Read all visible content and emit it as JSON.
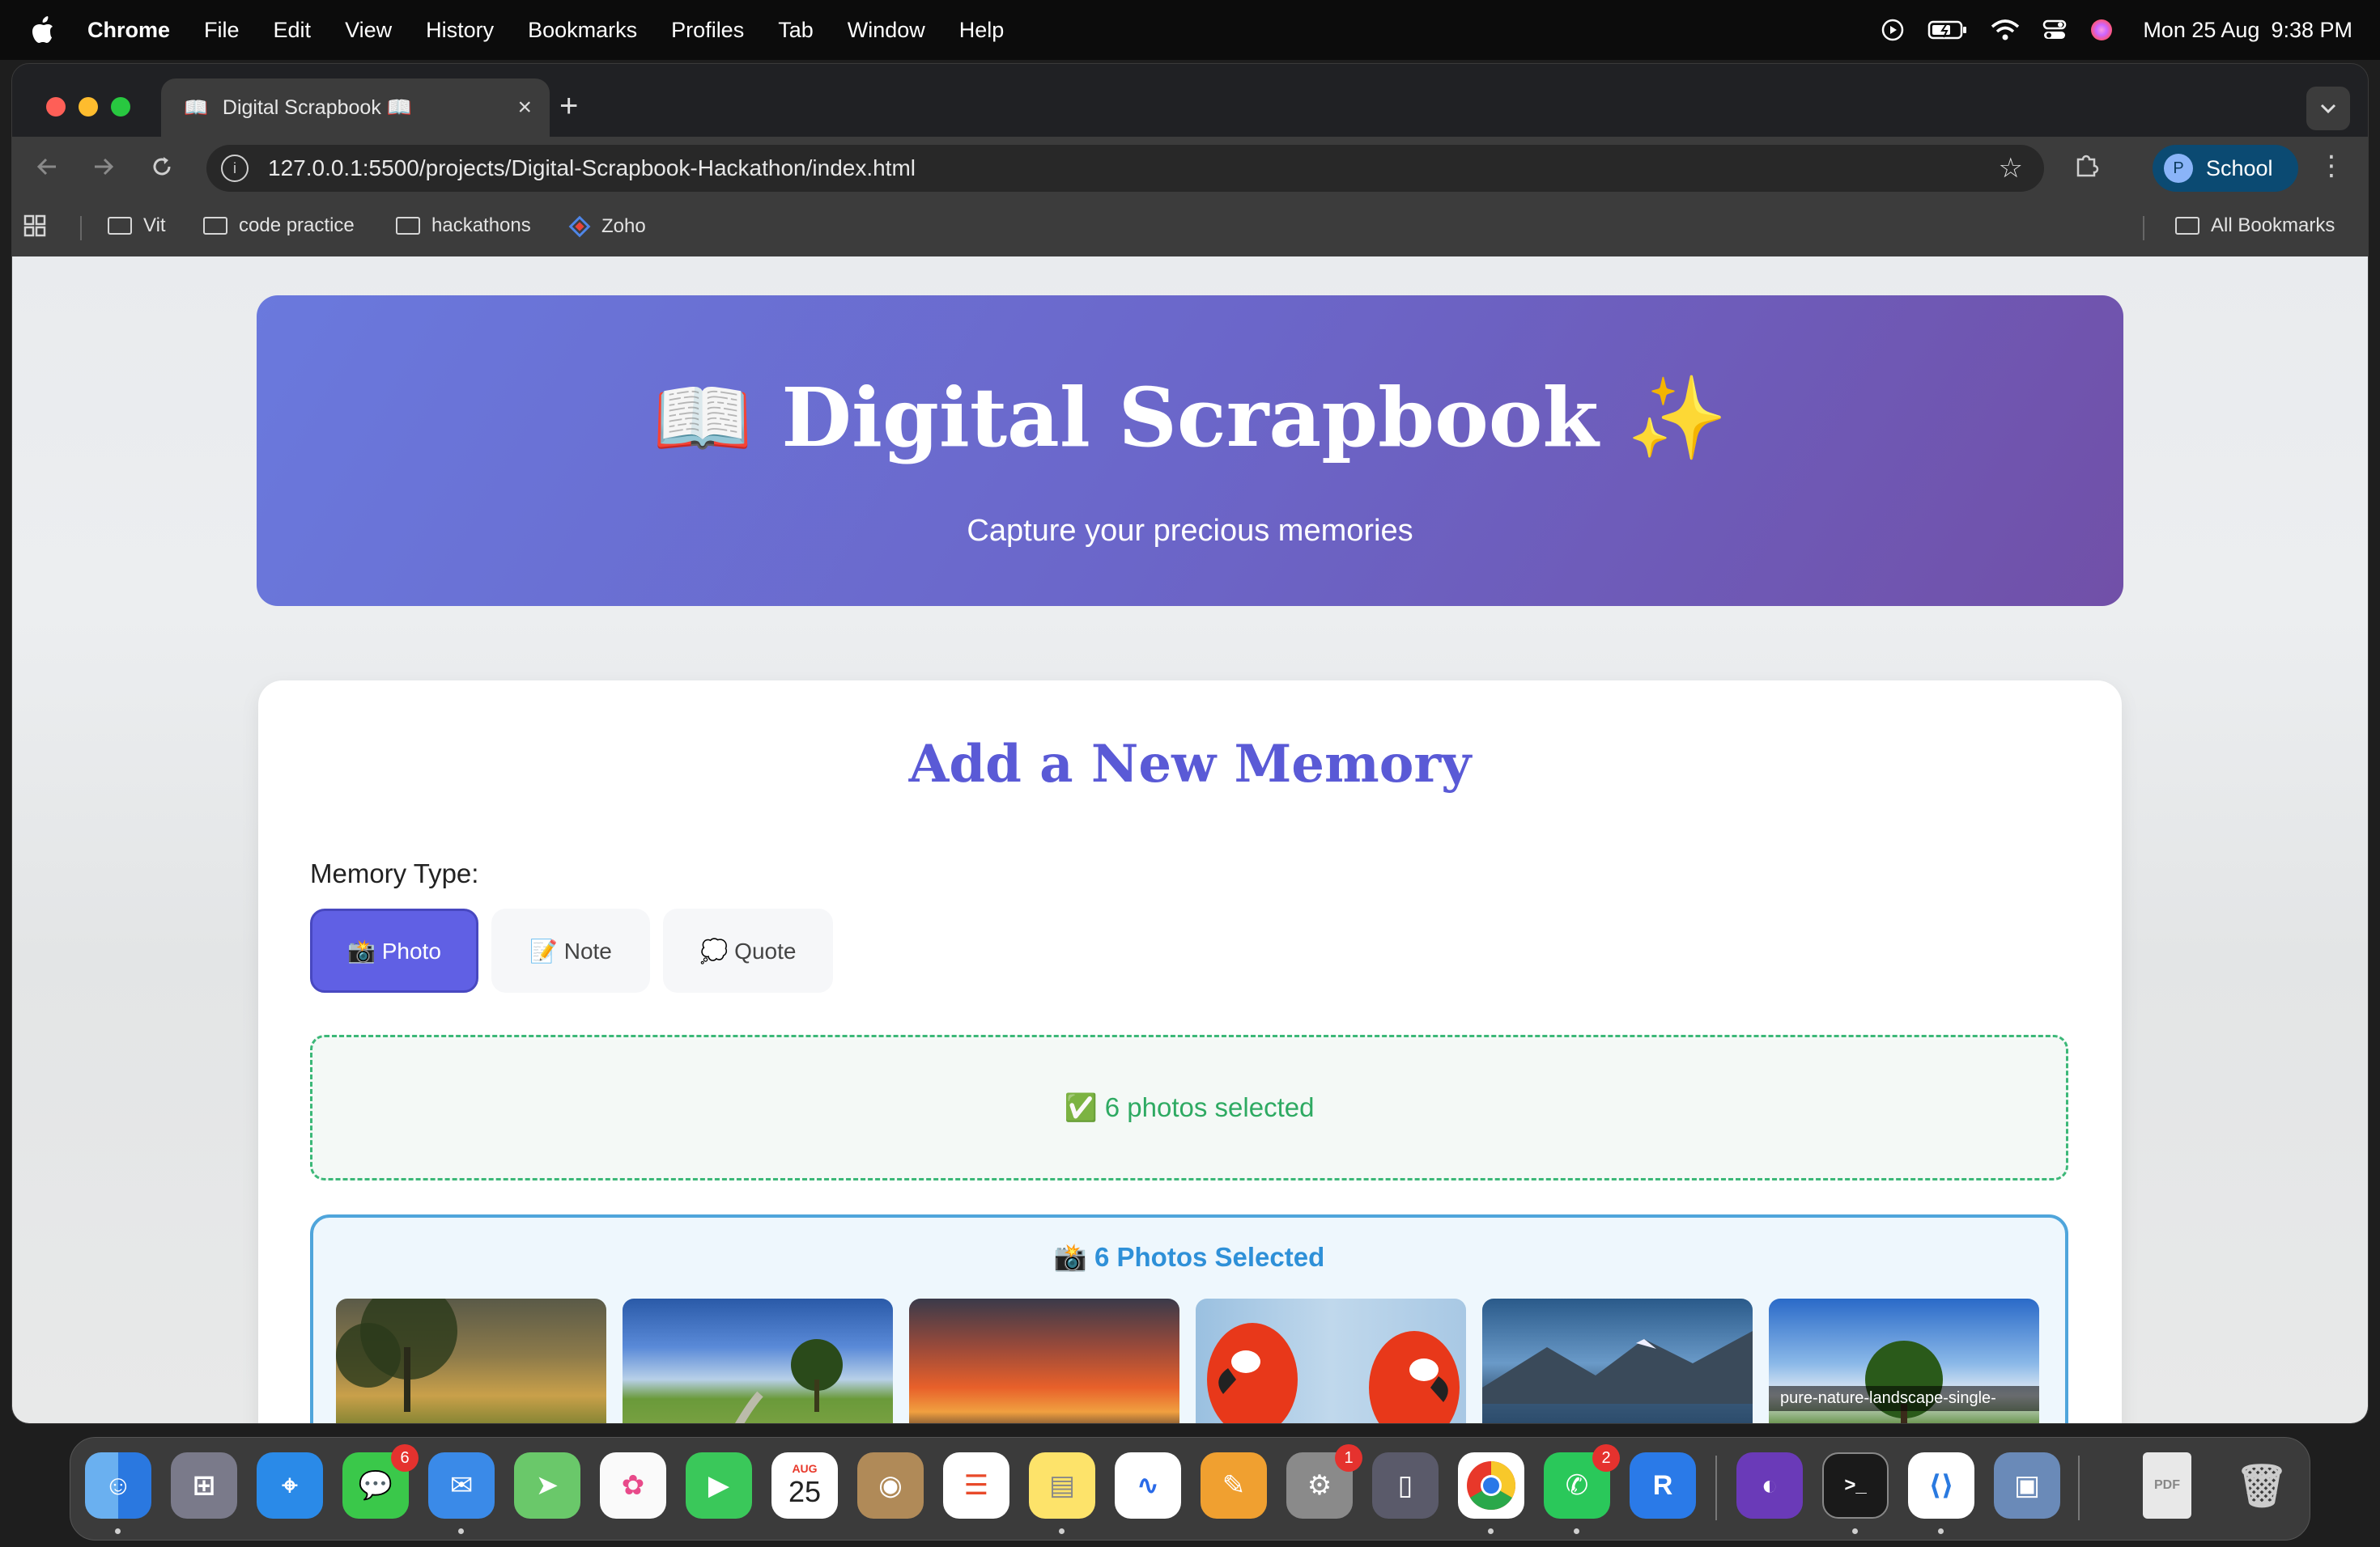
{
  "menubar": {
    "app": "Chrome",
    "items": [
      "File",
      "Edit",
      "View",
      "History",
      "Bookmarks",
      "Profiles",
      "Tab",
      "Window",
      "Help"
    ],
    "date": "Mon 25 Aug",
    "time": "9:38 PM"
  },
  "browser": {
    "tab_title": "Digital Scrapbook 📖",
    "tab_favicon": "📖",
    "url": "127.0.0.1:5500/projects/Digital-Scrapbook-Hackathon/index.html",
    "profile_initial": "P",
    "profile_name": "School",
    "bookmarks": [
      "Vit",
      "code practice",
      "hackathons",
      "Zoho"
    ],
    "all_bookmarks": "All Bookmarks"
  },
  "hero": {
    "title": "📖  Digital Scrapbook  ✨",
    "subtitle": "Capture your precious memories"
  },
  "form": {
    "heading": "Add a New Memory",
    "type_label": "Memory Type:",
    "types": [
      "📸 Photo",
      "📝 Note",
      "💭 Quote"
    ],
    "selected_type": "📸 Photo",
    "dropzone_status": "✅ 6 photos selected",
    "preview_title": "📸 6 Photos Selected",
    "last_photo_caption": "pure-nature-landscape-single-"
  },
  "dock": {
    "badges": {
      "messages": "6",
      "system_settings": "1",
      "whatsapp": "2"
    },
    "calendar_month": "AUG",
    "calendar_day": "25"
  },
  "colors": {
    "accent": "#6060e4",
    "success": "#2eaa62",
    "info": "#2e90d8"
  }
}
